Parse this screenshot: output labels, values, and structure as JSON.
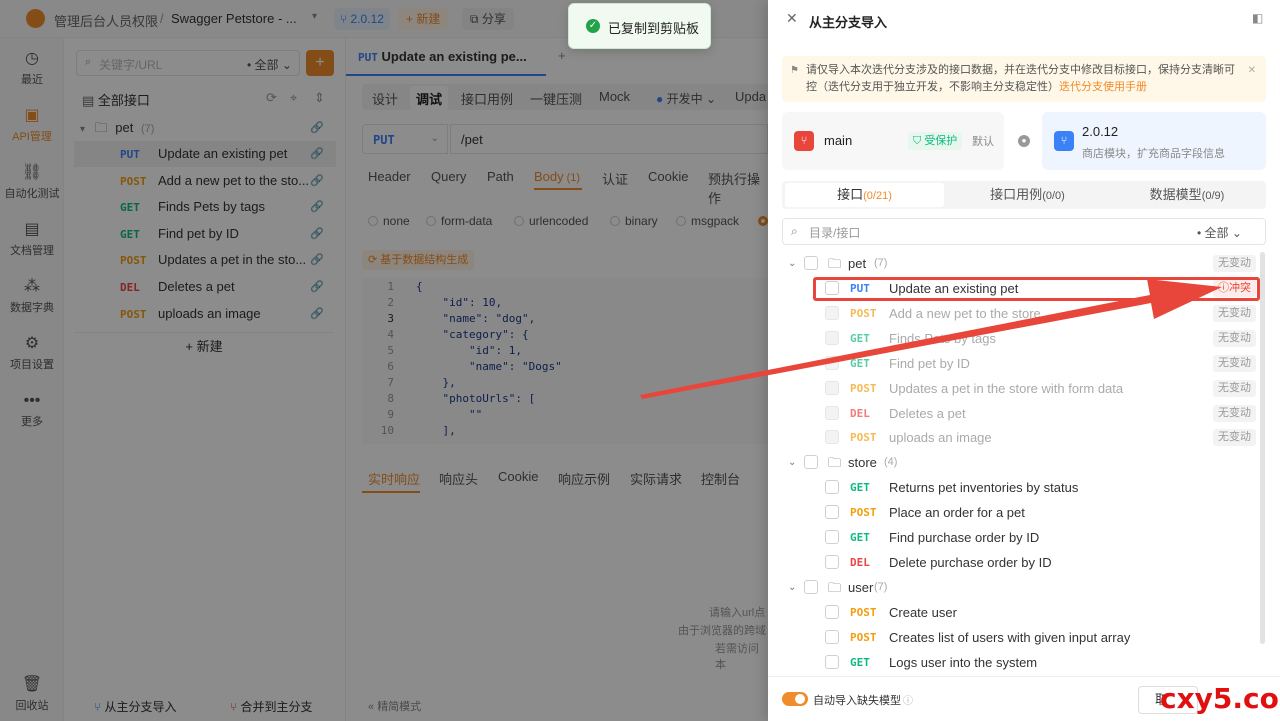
{
  "topbar": {
    "breadcrumb_team": "管理后台人员权限",
    "breadcrumb_sep": "/",
    "project_name": "Swagger Petstore - ...",
    "version_badge": "2.0.12",
    "new_label": "+ 新建",
    "share_label": "分享"
  },
  "toast": {
    "text": "已复制到剪贴板"
  },
  "rail": {
    "items": [
      {
        "icon": "clock-icon",
        "label": "最近"
      },
      {
        "icon": "api-icon",
        "label": "API管理"
      },
      {
        "icon": "automation-icon",
        "label": "自动化测试"
      },
      {
        "icon": "document-icon",
        "label": "文档管理"
      },
      {
        "icon": "dictionary-icon",
        "label": "数据字典"
      },
      {
        "icon": "settings-icon",
        "label": "项目设置"
      },
      {
        "icon": "more-icon",
        "label": "更多"
      }
    ],
    "trash_label": "回收站"
  },
  "sidebar": {
    "search_placeholder": "关键字/URL",
    "filter_value": "全部",
    "all_apis_label": "全部接口",
    "folder_name": "pet",
    "folder_count": "(7)",
    "items": [
      {
        "method": "PUT",
        "name": "Update an existing pet"
      },
      {
        "method": "POST",
        "name": "Add a new pet to the sto..."
      },
      {
        "method": "GET",
        "name": "Finds Pets by tags"
      },
      {
        "method": "GET",
        "name": "Find pet by ID"
      },
      {
        "method": "POST",
        "name": "Updates a pet in the sto..."
      },
      {
        "method": "DEL",
        "name": "Deletes a pet"
      },
      {
        "method": "POST",
        "name": "uploads an image"
      }
    ],
    "new_label": "+ 新建",
    "import_from_main": "从主分支导入",
    "merge_to_main": "合并到主分支"
  },
  "main": {
    "doc_tab_method": "PUT",
    "doc_tab_title": "Update an existing pe...",
    "view_tabs": [
      "设计",
      "调试",
      "接口用例",
      "一键压测",
      "Mock"
    ],
    "env_label": "开发中",
    "env_extra": "Upda",
    "method": "PUT",
    "path": "/pet",
    "param_tabs": [
      "Header",
      "Query",
      "Path",
      "Body",
      "认证",
      "Cookie",
      "预执行操作"
    ],
    "body_count": "(1)",
    "body_types": [
      "none",
      "form-data",
      "urlencoded",
      "binary",
      "msgpack"
    ],
    "generate_label": "基于数据结构生成",
    "code_lines": [
      {
        "n": "1",
        "text": "{"
      },
      {
        "n": "2",
        "text": "    \"id\": 10,"
      },
      {
        "n": "3",
        "text": "    \"name\": \"dog\","
      },
      {
        "n": "4",
        "text": "    \"category\": {"
      },
      {
        "n": "5",
        "text": "        \"id\": 1,"
      },
      {
        "n": "6",
        "text": "        \"name\": \"Dogs\""
      },
      {
        "n": "7",
        "text": "    },"
      },
      {
        "n": "8",
        "text": "    \"photoUrls\": ["
      },
      {
        "n": "9",
        "text": "        \"\""
      },
      {
        "n": "10",
        "text": "    ],"
      }
    ],
    "response_tabs": [
      "实时响应",
      "响应头",
      "Cookie",
      "响应示例",
      "实际请求",
      "控制台"
    ],
    "hint_lines": [
      "请输入url点",
      "由于浏览器的跨域",
      "若需访问本"
    ],
    "simple_mode": "精简模式"
  },
  "drawer": {
    "title": "从主分支导入",
    "notice": "请仅导入本次迭代分支涉及的接口数据，并在迭代分支中修改目标接口，保持分支清晰可控（迭代分支用于独立开发，不影响主分支稳定性）",
    "notice_link": "迭代分支使用手册",
    "source_branch": "main",
    "protected_label": "受保护",
    "default_label": "默认",
    "target_branch": "2.0.12",
    "target_desc": "商店模块，扩充商品字段信息",
    "tabs": [
      {
        "label": "接口",
        "count": "(0/21)"
      },
      {
        "label": "接口用例",
        "count": "(0/0)"
      },
      {
        "label": "数据模型",
        "count": "(0/9)"
      }
    ],
    "search_placeholder": "目录/接口",
    "filter_value": "全部",
    "folders": [
      {
        "name": "pet",
        "count": "(7)",
        "badge": "无变动"
      },
      {
        "name": "store",
        "count": "(4)",
        "badge": ""
      },
      {
        "name": "user",
        "count": "(7)",
        "badge": ""
      }
    ],
    "pet_items": [
      {
        "method": "PUT",
        "name": "Update an existing pet",
        "badge": "冲突"
      },
      {
        "method": "POST",
        "name": "Add a new pet to the store",
        "badge": "无变动"
      },
      {
        "method": "GET",
        "name": "Finds Pets by tags",
        "badge": "无变动"
      },
      {
        "method": "GET",
        "name": "Find pet by ID",
        "badge": "无变动"
      },
      {
        "method": "POST",
        "name": "Updates a pet in the store with form data",
        "badge": "无变动"
      },
      {
        "method": "DEL",
        "name": "Deletes a pet",
        "badge": "无变动"
      },
      {
        "method": "POST",
        "name": "uploads an image",
        "badge": "无变动"
      }
    ],
    "store_items": [
      {
        "method": "GET",
        "name": "Returns pet inventories by status"
      },
      {
        "method": "POST",
        "name": "Place an order for a pet"
      },
      {
        "method": "GET",
        "name": "Find purchase order by ID"
      },
      {
        "method": "DEL",
        "name": "Delete purchase order by ID"
      }
    ],
    "user_items": [
      {
        "method": "POST",
        "name": "Create user"
      },
      {
        "method": "POST",
        "name": "Creates list of users with given input array"
      },
      {
        "method": "GET",
        "name": "Logs user into the system"
      }
    ],
    "auto_import_label": "自动导入缺失模型",
    "cancel_label": "取"
  },
  "watermark": "cxy5.com",
  "colors": {
    "accent": "#f08c2c",
    "conflict": "#e8463a",
    "put": "#3b82f6",
    "post": "#f59e0b",
    "get": "#10b981",
    "del": "#ef4444"
  }
}
